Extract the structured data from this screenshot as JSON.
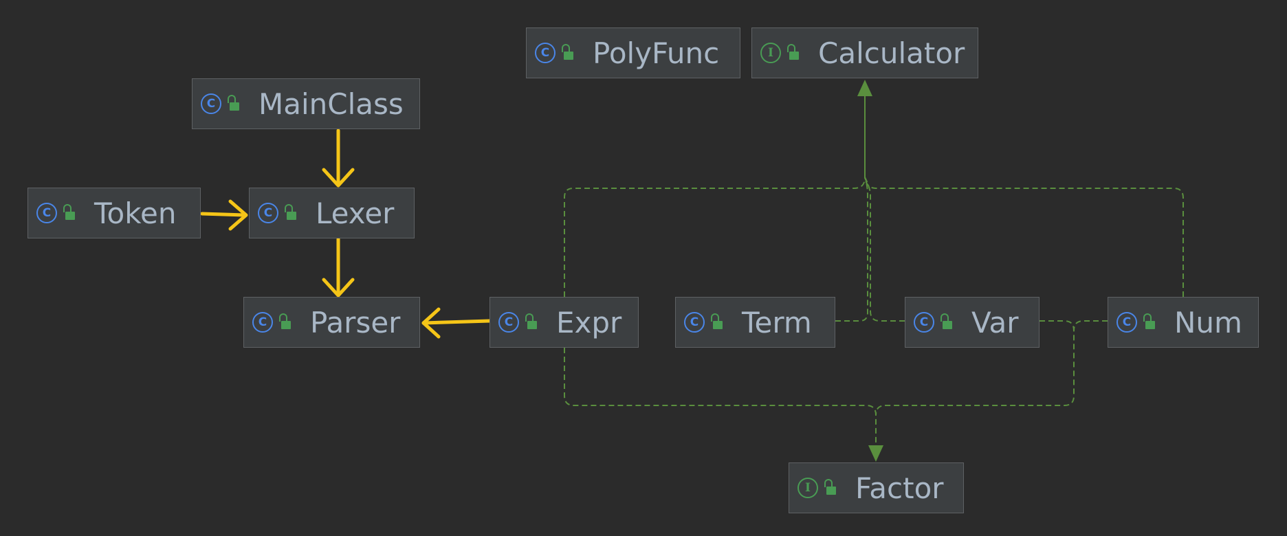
{
  "diagram": {
    "nodes": [
      {
        "id": "polyfunc",
        "label": "PolyFunc",
        "kind": "class",
        "kind_glyph": "C"
      },
      {
        "id": "calculator",
        "label": "Calculator",
        "kind": "interface",
        "kind_glyph": "I"
      },
      {
        "id": "mainclass",
        "label": "MainClass",
        "kind": "class",
        "kind_glyph": "C"
      },
      {
        "id": "token",
        "label": "Token",
        "kind": "class",
        "kind_glyph": "C"
      },
      {
        "id": "lexer",
        "label": "Lexer",
        "kind": "class",
        "kind_glyph": "C"
      },
      {
        "id": "parser",
        "label": "Parser",
        "kind": "class",
        "kind_glyph": "C"
      },
      {
        "id": "expr",
        "label": "Expr",
        "kind": "class",
        "kind_glyph": "C"
      },
      {
        "id": "term",
        "label": "Term",
        "kind": "class",
        "kind_glyph": "C"
      },
      {
        "id": "var",
        "label": "Var",
        "kind": "class",
        "kind_glyph": "C"
      },
      {
        "id": "num",
        "label": "Num",
        "kind": "class",
        "kind_glyph": "C"
      },
      {
        "id": "factor",
        "label": "Factor",
        "kind": "interface",
        "kind_glyph": "I"
      }
    ],
    "edges": [
      {
        "from": "mainclass",
        "to": "lexer",
        "type": "dependency"
      },
      {
        "from": "token",
        "to": "lexer",
        "type": "dependency"
      },
      {
        "from": "lexer",
        "to": "parser",
        "type": "dependency"
      },
      {
        "from": "expr",
        "to": "parser",
        "type": "dependency"
      },
      {
        "from": "expr",
        "to": "calculator",
        "type": "realization"
      },
      {
        "from": "term",
        "to": "calculator",
        "type": "realization"
      },
      {
        "from": "var",
        "to": "calculator",
        "type": "realization"
      },
      {
        "from": "num",
        "to": "calculator",
        "type": "realization"
      },
      {
        "from": "expr",
        "to": "factor",
        "type": "realization"
      },
      {
        "from": "var",
        "to": "factor",
        "type": "realization"
      },
      {
        "from": "num",
        "to": "factor",
        "type": "realization"
      }
    ]
  },
  "colors": {
    "background": "#2b2b2b",
    "node_fill": "#3c3f41",
    "node_border": "#5e6164",
    "label": "#a9b7c6",
    "class_icon": "#4a86e8",
    "interface_icon": "#499c54",
    "dependency_arrow": "#f5c518",
    "realization_line": "#5a8f3e"
  },
  "icons": {
    "class": "class-c-icon",
    "interface": "interface-i-icon",
    "visibility": "public-lock-icon"
  }
}
